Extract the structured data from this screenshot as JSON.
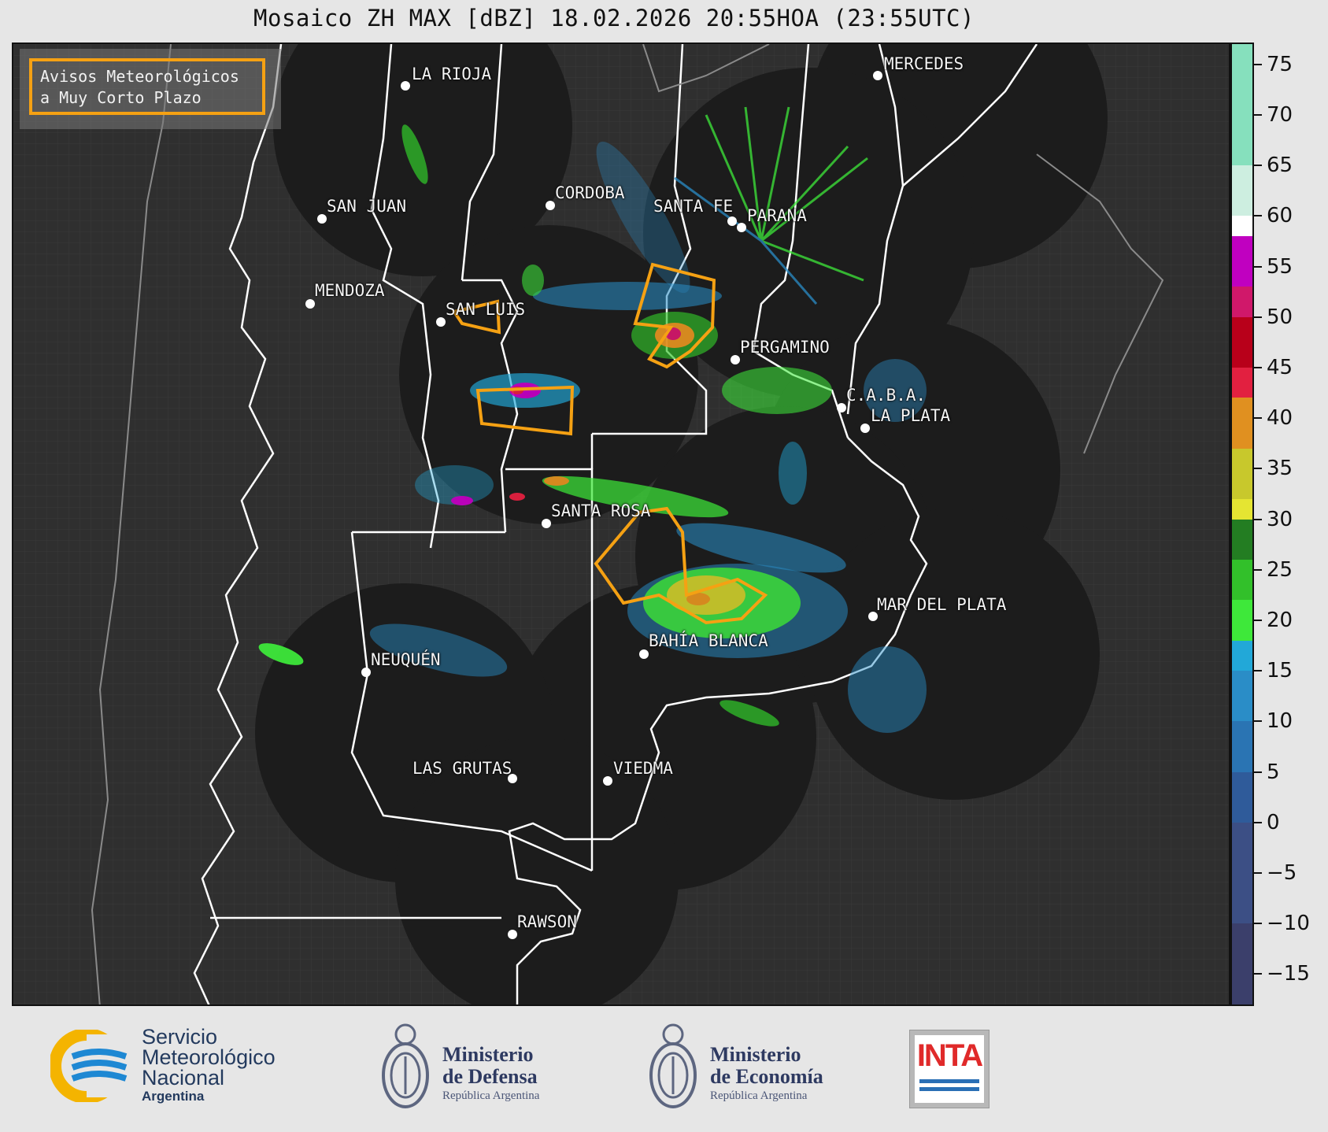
{
  "title": "Mosaico ZH MAX [dBZ] 18.02.2026 20:55HOA (23:55UTC)",
  "legend": {
    "line1": "Avisos Meteorológicos",
    "line2": "a Muy Corto Plazo",
    "border_color": "#f5a113"
  },
  "cities": [
    {
      "name": "LA RIOJA"
    },
    {
      "name": "MERCEDES"
    },
    {
      "name": "SAN JUAN"
    },
    {
      "name": "CORDOBA"
    },
    {
      "name": "SANTA FE"
    },
    {
      "name": "PARANA"
    },
    {
      "name": "MENDOZA"
    },
    {
      "name": "SAN LUIS"
    },
    {
      "name": "PERGAMINO"
    },
    {
      "name": "C.A.B.A."
    },
    {
      "name": "LA PLATA"
    },
    {
      "name": "SANTA ROSA"
    },
    {
      "name": "MAR DEL PLATA"
    },
    {
      "name": "BAHÍA BLANCA"
    },
    {
      "name": "NEUQUÉN"
    },
    {
      "name": "LAS GRUTAS"
    },
    {
      "name": "VIEDMA"
    },
    {
      "name": "RAWSON"
    }
  ],
  "colorbar": {
    "unit": "dBZ",
    "range": [
      -18,
      77
    ],
    "ticks": [
      "75",
      "70",
      "65",
      "60",
      "55",
      "50",
      "45",
      "40",
      "35",
      "30",
      "25",
      "20",
      "15",
      "10",
      "5",
      "0",
      "−5",
      "−10",
      "−15"
    ],
    "tick_values": [
      75,
      70,
      65,
      60,
      55,
      50,
      45,
      40,
      35,
      30,
      25,
      20,
      15,
      10,
      5,
      0,
      -5,
      -10,
      -15
    ],
    "color_stops": [
      {
        "from": -18,
        "to": -10,
        "color": "#3b3f6b"
      },
      {
        "from": -10,
        "to": 0,
        "color": "#3c4f85"
      },
      {
        "from": 0,
        "to": 5,
        "color": "#2f5b9a"
      },
      {
        "from": 5,
        "to": 10,
        "color": "#2a74b3"
      },
      {
        "from": 10,
        "to": 15,
        "color": "#2a8dc7"
      },
      {
        "from": 15,
        "to": 18,
        "color": "#22a8d8"
      },
      {
        "from": 18,
        "to": 22,
        "color": "#3ee83a"
      },
      {
        "from": 22,
        "to": 26,
        "color": "#32c02a"
      },
      {
        "from": 26,
        "to": 30,
        "color": "#237d22"
      },
      {
        "from": 30,
        "to": 32,
        "color": "#e5e532"
      },
      {
        "from": 32,
        "to": 37,
        "color": "#c8c82c"
      },
      {
        "from": 37,
        "to": 42,
        "color": "#e09020"
      },
      {
        "from": 42,
        "to": 45,
        "color": "#e22040"
      },
      {
        "from": 45,
        "to": 50,
        "color": "#b8001a"
      },
      {
        "from": 50,
        "to": 53,
        "color": "#d0186a"
      },
      {
        "from": 53,
        "to": 58,
        "color": "#c000c0"
      },
      {
        "from": 58,
        "to": 60,
        "color": "#ffffff"
      },
      {
        "from": 60,
        "to": 65,
        "color": "#cdeee0"
      },
      {
        "from": 65,
        "to": 77,
        "color": "#86e0bd"
      }
    ]
  },
  "footer": {
    "smn": {
      "line1": "Servicio",
      "line2": "Meteorológico",
      "line3": "Nacional",
      "line4": "Argentina"
    },
    "defensa": {
      "line1": "Ministerio",
      "line2": "de Defensa",
      "line3": "República Argentina"
    },
    "economia": {
      "line1": "Ministerio",
      "line2": "de Economía",
      "line3": "República Argentina"
    },
    "inta": {
      "word": "INTA"
    }
  }
}
